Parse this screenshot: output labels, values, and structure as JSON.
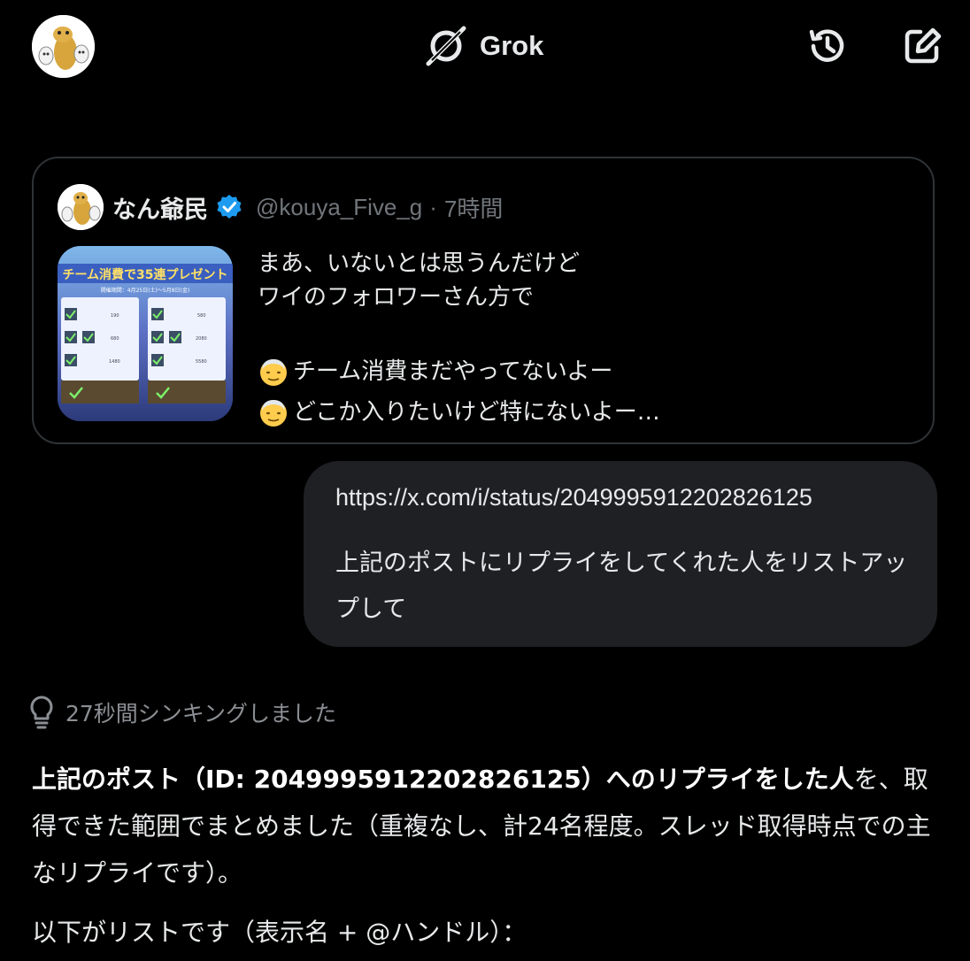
{
  "header": {
    "brand_name": "Grok",
    "avatar_icon": "mascot-avatar-icon",
    "history_icon": "history-icon",
    "compose_icon": "compose-icon"
  },
  "quoted_post": {
    "author_name": "なん爺民",
    "verified": true,
    "handle": "@kouya_Five_g",
    "separator": "·",
    "time": "7時間",
    "image_text": {
      "title": "チーム消費で35連プレゼント",
      "period": "開催期間：4月25日(土)〜5月8日(金)",
      "rows": [
        "190",
        "680",
        "1480",
        "580",
        "2080",
        "5580"
      ]
    },
    "text_lines": [
      "まあ、いないとは思うんだけど",
      "ワイのフォロワーさん方で",
      "",
      "チーム消費まだやってないよー",
      "どこか入りたいけど特にないよー…"
    ]
  },
  "user_message": {
    "url": "https://x.com/i/status/2049995912202826125",
    "text": "上記のポストにリプライをしてくれた人をリストアップして"
  },
  "thinking": {
    "label": "27秒間シンキングしました"
  },
  "answer": {
    "bold_part": "上記のポスト（ID: 2049995912202826125）へのリプライをした人",
    "rest_part": "を、取得できた範囲でまとめました（重複なし、計24名程度。スレッド取得時点での主なリプライです）。",
    "list_intro": "以下がリストです（表示名 + @ハンドル）："
  },
  "colors": {
    "background": "#000000",
    "card_border": "#2f3336",
    "bubble_bg": "#1f2023",
    "muted_text": "#71767b",
    "verified_blue": "#1d9bf0"
  }
}
